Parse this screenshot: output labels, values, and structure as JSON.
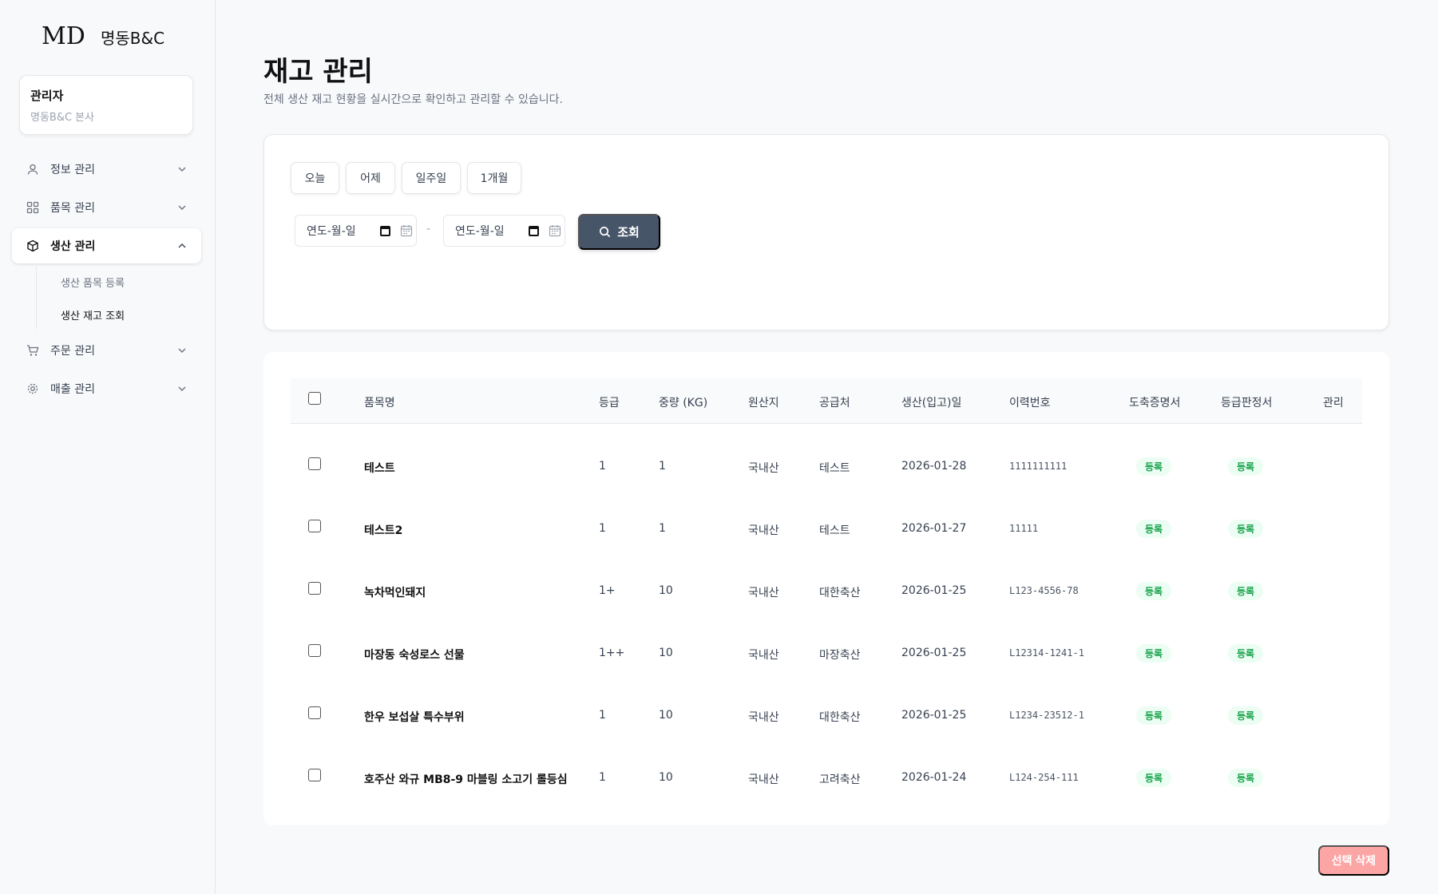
{
  "brand": {
    "logo": "MD",
    "name": "명동B&C"
  },
  "user": {
    "role": "관리자",
    "org": "명동B&C 본사"
  },
  "nav": [
    {
      "label": "정보 관리",
      "icon": "user-icon"
    },
    {
      "label": "품목 관리",
      "icon": "grid-icon"
    },
    {
      "label": "생산 관리",
      "icon": "box-icon",
      "active": true
    },
    {
      "label": "주문 관리",
      "icon": "cart-icon"
    },
    {
      "label": "매출 관리",
      "icon": "gear-icon"
    }
  ],
  "subnav": [
    "생산 품목 등록",
    "생산 재고 조회"
  ],
  "page": {
    "title": "재고 관리",
    "description": "전체 생산 재고 현황을 실시간으로 확인하고 관리할 수 있습니다."
  },
  "filters": {
    "quick": [
      "오늘",
      "어제",
      "일주일",
      "1개월"
    ],
    "date_placeholder": "연도-월-일",
    "separator": "-",
    "search_label": "조회"
  },
  "table": {
    "headers": [
      "품목명",
      "등급",
      "중량 (KG)",
      "원산지",
      "공급처",
      "생산(입고)일",
      "이력번호",
      "도축증명서",
      "등급판정서",
      "관리"
    ],
    "rows": [
      {
        "name": "테스트",
        "grade": "1",
        "weight": "1",
        "origin": "국내산",
        "supplier": "테스트",
        "date": "2026-01-28",
        "trace": "1111111111",
        "cert": "등록",
        "grade_doc": "등록"
      },
      {
        "name": "테스트2",
        "grade": "1",
        "weight": "1",
        "origin": "국내산",
        "supplier": "테스트",
        "date": "2026-01-27",
        "trace": "11111",
        "cert": "등록",
        "grade_doc": "등록"
      },
      {
        "name": "녹차먹인돼지",
        "grade": "1+",
        "weight": "10",
        "origin": "국내산",
        "supplier": "대한축산",
        "date": "2026-01-25",
        "trace": "L123-4556-78",
        "cert": "등록",
        "grade_doc": "등록"
      },
      {
        "name": "마장동 숙성로스 선물",
        "grade": "1++",
        "weight": "10",
        "origin": "국내산",
        "supplier": "마장축산",
        "date": "2026-01-25",
        "trace": "L12314-1241-1",
        "cert": "등록",
        "grade_doc": "등록"
      },
      {
        "name": "한우 보섭살 특수부위",
        "grade": "1",
        "weight": "10",
        "origin": "국내산",
        "supplier": "대한축산",
        "date": "2026-01-25",
        "trace": "L1234-23512-1",
        "cert": "등록",
        "grade_doc": "등록"
      },
      {
        "name": "호주산 와규 MB8-9 마블링 소고기 롤등심",
        "grade": "1",
        "weight": "10",
        "origin": "국내산",
        "supplier": "고려축산",
        "date": "2026-01-24",
        "trace": "L124-254-111",
        "cert": "등록",
        "grade_doc": "등록"
      }
    ]
  },
  "actions": {
    "delete_label": "선택 삭제"
  },
  "colors": {
    "primary": "#475569",
    "danger": "#fca5a5",
    "badge_bg": "#ecfdf3",
    "badge_text": "#16a34a"
  }
}
